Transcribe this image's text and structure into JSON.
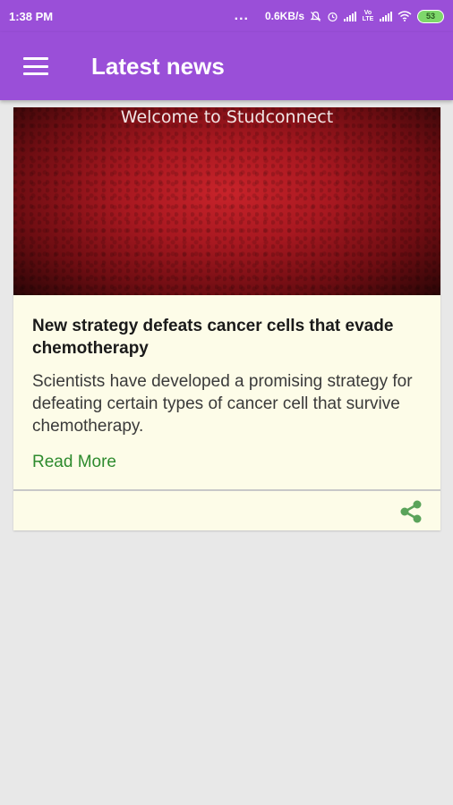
{
  "status_bar": {
    "time": "1:38 PM",
    "dots": "...",
    "net_speed": "0.6KB/s",
    "battery": "53",
    "volte_label": "Vo LTE"
  },
  "app_bar": {
    "title": "Latest news",
    "menu_icon": "hamburger-menu-icon"
  },
  "news_card": {
    "image_caption": "Welcome to Studconnect",
    "title": "New strategy defeats cancer cells that evade chemotherapy",
    "description": "Scientists have developed a promising strategy for defeating certain types of cancer cell that survive chemotherapy.",
    "read_more_label": "Read More",
    "share_icon": "share-icon"
  },
  "colors": {
    "primary": "#9a4fd8",
    "card_background": "#fdfce8",
    "link": "#2e8b2e",
    "share": "#5aa35a"
  }
}
